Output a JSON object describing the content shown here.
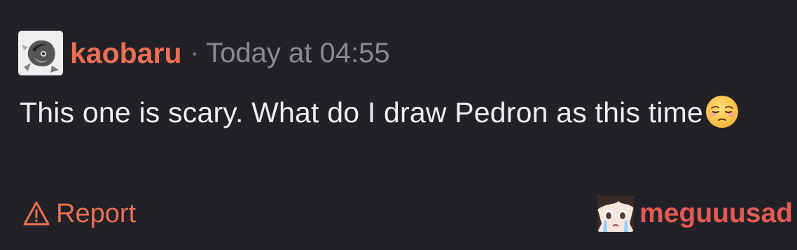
{
  "message": {
    "author": "kaobaru",
    "separator": "·",
    "timestamp": "Today at 04:55",
    "text": "This one is scary. What do I draw Pedron as this time",
    "emoji": "pensive-face",
    "avatar_icon": "sketch-avatar"
  },
  "actions": {
    "report_label": "Report",
    "report_icon": "warning-triangle-icon"
  },
  "reactor": {
    "name": "meguuusad",
    "avatar_icon": "crying-anime-avatar"
  },
  "colors": {
    "background": "#212126",
    "author": "#ec6f55",
    "timestamp": "#8a8a8f",
    "text": "#eceff4",
    "report": "#ec6f55",
    "reactor": "#e45a55"
  }
}
